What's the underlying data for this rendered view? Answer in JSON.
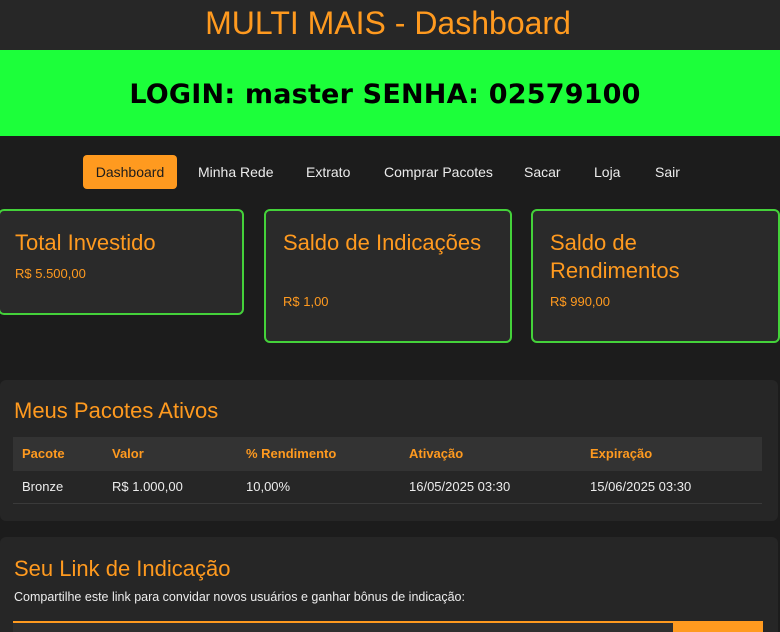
{
  "header": {
    "title": "MULTI MAIS - Dashboard"
  },
  "banner": {
    "text": "LOGIN: master SENHA:  02579100"
  },
  "nav": {
    "items": [
      {
        "label": "Dashboard",
        "active": true
      },
      {
        "label": "Minha Rede",
        "active": false
      },
      {
        "label": "Extrato",
        "active": false
      },
      {
        "label": "Comprar Pacotes",
        "active": false
      },
      {
        "label": "Sacar",
        "active": false
      },
      {
        "label": "Loja",
        "active": false
      },
      {
        "label": "Sair",
        "active": false
      }
    ]
  },
  "cards": [
    {
      "title": "Total Investido",
      "value": "R$ 5.500,00"
    },
    {
      "title": "Saldo de Indicações",
      "value": "R$ 1,00"
    },
    {
      "title": "Saldo de Rendimentos",
      "value": "R$ 990,00"
    }
  ],
  "packages": {
    "title": "Meus Pacotes Ativos",
    "columns": [
      "Pacote",
      "Valor",
      "% Rendimento",
      "Ativação",
      "Expiração"
    ],
    "rows": [
      [
        "Bronze",
        "R$ 1.000,00",
        "10,00%",
        "16/05/2025 03:30",
        "15/06/2025 03:30"
      ]
    ]
  },
  "referral": {
    "title": "Seu Link de Indicação",
    "description": "Compartilhe este link para convidar novos usuários e ganhar bônus de indicação:"
  },
  "colors": {
    "accent": "#ff9a1f",
    "banner": "#1cff3a",
    "card_border": "#44d13a",
    "background": "#1c1c1c"
  }
}
